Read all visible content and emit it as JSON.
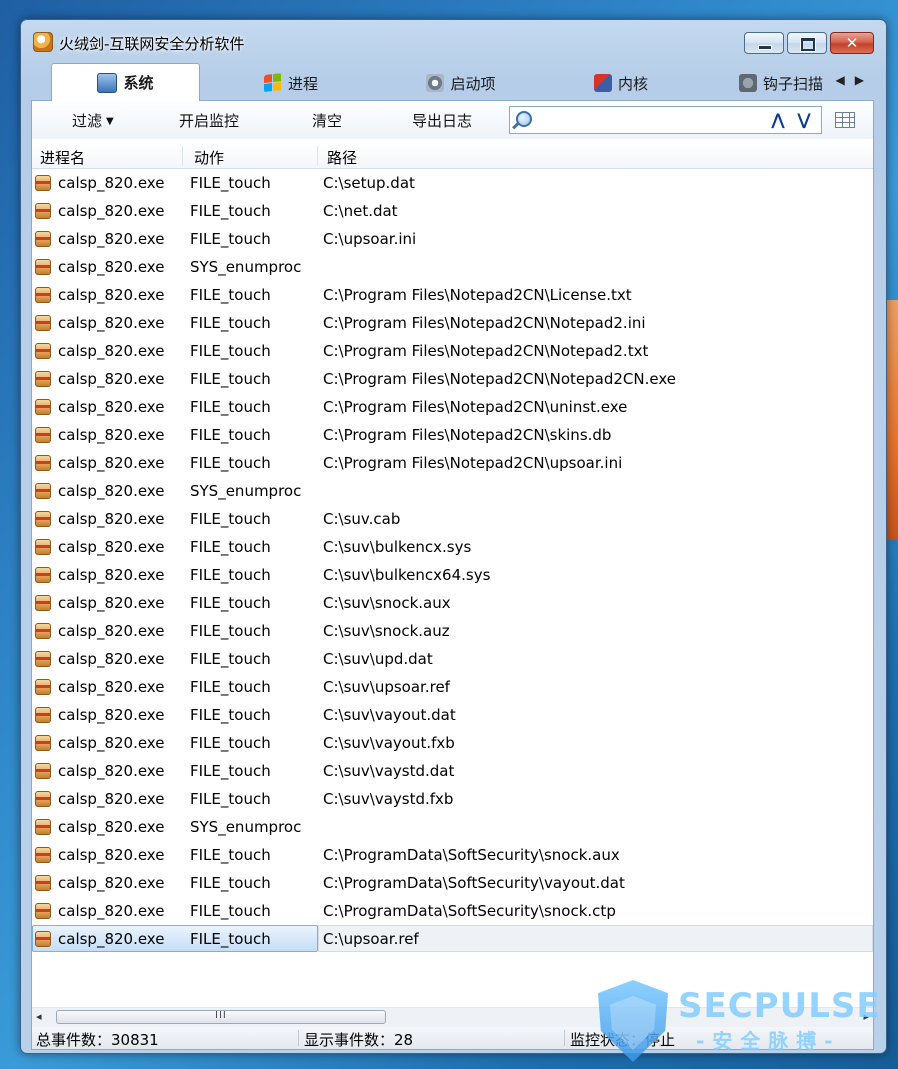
{
  "window": {
    "title": "火绒剑-互联网安全分析软件"
  },
  "tabs": [
    {
      "label": "系统",
      "icon": "system-icon",
      "active": true
    },
    {
      "label": "进程",
      "icon": "process-icon",
      "active": false
    },
    {
      "label": "启动项",
      "icon": "startup-icon",
      "active": false
    },
    {
      "label": "内核",
      "icon": "kernel-icon",
      "active": false
    },
    {
      "label": "钩子扫描",
      "icon": "hook-scan-icon",
      "active": false
    }
  ],
  "tab_scroll": {
    "left": "◀",
    "right": "▶"
  },
  "toolbar": {
    "filter_label": "过滤",
    "filter_caret": "▼",
    "monitor_label": "开启监控",
    "clear_label": "清空",
    "export_label": "导出日志",
    "search": {
      "value": "",
      "placeholder": ""
    },
    "nav_up": "⋀",
    "nav_down": "⋁"
  },
  "columns": {
    "process": "进程名",
    "action": "动作",
    "path": "路径"
  },
  "rows": [
    {
      "process": "calsp_820.exe",
      "action": "FILE_touch",
      "path": "C:\\setup.dat"
    },
    {
      "process": "calsp_820.exe",
      "action": "FILE_touch",
      "path": "C:\\net.dat"
    },
    {
      "process": "calsp_820.exe",
      "action": "FILE_touch",
      "path": "C:\\upsoar.ini"
    },
    {
      "process": "calsp_820.exe",
      "action": "SYS_enumproc",
      "path": ""
    },
    {
      "process": "calsp_820.exe",
      "action": "FILE_touch",
      "path": "C:\\Program Files\\Notepad2CN\\License.txt"
    },
    {
      "process": "calsp_820.exe",
      "action": "FILE_touch",
      "path": "C:\\Program Files\\Notepad2CN\\Notepad2.ini"
    },
    {
      "process": "calsp_820.exe",
      "action": "FILE_touch",
      "path": "C:\\Program Files\\Notepad2CN\\Notepad2.txt"
    },
    {
      "process": "calsp_820.exe",
      "action": "FILE_touch",
      "path": "C:\\Program Files\\Notepad2CN\\Notepad2CN.exe"
    },
    {
      "process": "calsp_820.exe",
      "action": "FILE_touch",
      "path": "C:\\Program Files\\Notepad2CN\\uninst.exe"
    },
    {
      "process": "calsp_820.exe",
      "action": "FILE_touch",
      "path": "C:\\Program Files\\Notepad2CN\\skins.db"
    },
    {
      "process": "calsp_820.exe",
      "action": "FILE_touch",
      "path": "C:\\Program Files\\Notepad2CN\\upsoar.ini"
    },
    {
      "process": "calsp_820.exe",
      "action": "SYS_enumproc",
      "path": ""
    },
    {
      "process": "calsp_820.exe",
      "action": "FILE_touch",
      "path": "C:\\suv.cab"
    },
    {
      "process": "calsp_820.exe",
      "action": "FILE_touch",
      "path": "C:\\suv\\bulkencx.sys"
    },
    {
      "process": "calsp_820.exe",
      "action": "FILE_touch",
      "path": "C:\\suv\\bulkencx64.sys"
    },
    {
      "process": "calsp_820.exe",
      "action": "FILE_touch",
      "path": "C:\\suv\\snock.aux"
    },
    {
      "process": "calsp_820.exe",
      "action": "FILE_touch",
      "path": "C:\\suv\\snock.auz"
    },
    {
      "process": "calsp_820.exe",
      "action": "FILE_touch",
      "path": "C:\\suv\\upd.dat"
    },
    {
      "process": "calsp_820.exe",
      "action": "FILE_touch",
      "path": "C:\\suv\\upsoar.ref"
    },
    {
      "process": "calsp_820.exe",
      "action": "FILE_touch",
      "path": "C:\\suv\\vayout.dat"
    },
    {
      "process": "calsp_820.exe",
      "action": "FILE_touch",
      "path": "C:\\suv\\vayout.fxb"
    },
    {
      "process": "calsp_820.exe",
      "action": "FILE_touch",
      "path": "C:\\suv\\vaystd.dat"
    },
    {
      "process": "calsp_820.exe",
      "action": "FILE_touch",
      "path": "C:\\suv\\vaystd.fxb"
    },
    {
      "process": "calsp_820.exe",
      "action": "SYS_enumproc",
      "path": ""
    },
    {
      "process": "calsp_820.exe",
      "action": "FILE_touch",
      "path": "C:\\ProgramData\\SoftSecurity\\snock.aux"
    },
    {
      "process": "calsp_820.exe",
      "action": "FILE_touch",
      "path": "C:\\ProgramData\\SoftSecurity\\vayout.dat"
    },
    {
      "process": "calsp_820.exe",
      "action": "FILE_touch",
      "path": "C:\\ProgramData\\SoftSecurity\\snock.ctp"
    },
    {
      "process": "calsp_820.exe",
      "action": "FILE_touch",
      "path": "C:\\upsoar.ref",
      "selected": true
    }
  ],
  "scrollbar": {
    "left_arrow": "◂",
    "right_arrow": "▸",
    "grip": "III"
  },
  "status": {
    "total": "总事件数：30831",
    "shown": "显示事件数：28",
    "monitor": "监控状态：停止"
  },
  "watermark": {
    "text": "SECPULSE",
    "subtext": "-安全脉搏-"
  },
  "colors": {
    "desktop": "#2f86c9",
    "window_frame": "#b9d0ea",
    "selection": "#c6def6",
    "close_button": "#c4412b"
  }
}
